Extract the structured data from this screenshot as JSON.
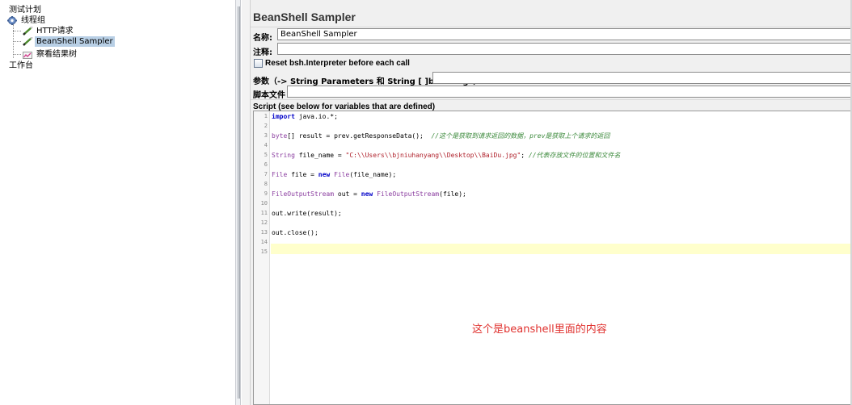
{
  "tree": {
    "items": [
      {
        "label": "测试计划",
        "icon": "test-plan-icon"
      },
      {
        "label": "线程组",
        "icon": "thread-group-gear-icon"
      },
      {
        "label": "HTTP请求",
        "icon": "http-sampler-pencil-icon"
      },
      {
        "label": "BeanShell Sampler",
        "icon": "beanshell-sampler-pencil-icon"
      },
      {
        "label": "察看结果树",
        "icon": "view-results-tree-icon"
      },
      {
        "label": "工作台",
        "icon": ""
      }
    ]
  },
  "panel": {
    "title": "BeanShell Sampler",
    "name_label": "名称:",
    "name_value": "BeanShell Sampler",
    "comment_label": "注释:",
    "comment_value": "",
    "reset_label": "Reset bsh.Interpreter before each call",
    "reset_checked": false,
    "params_label": "参数（-> String Parameters 和 String [ ]bash.args）",
    "params_value": "",
    "script_file_label": "脚本文件",
    "script_file_value": "",
    "script_label": "Script (see below for variables that are defined)"
  },
  "editor": {
    "line_numbers": [
      "1",
      "2",
      "3",
      "4",
      "5",
      "6",
      "7",
      "8",
      "9",
      "10",
      "11",
      "12",
      "13",
      "14",
      "15"
    ],
    "lines": [
      {
        "tokens": [
          {
            "t": "import",
            "c": "kw"
          },
          {
            "t": " java.io.*;",
            "c": ""
          }
        ]
      },
      {
        "tokens": []
      },
      {
        "tokens": [
          {
            "t": "byte",
            "c": "ty"
          },
          {
            "t": "[] result = prev.getResponseData();  ",
            "c": ""
          },
          {
            "t": "//这个是获取到请求返回的数据，prev是获取上个请求的返回",
            "c": "cm"
          }
        ]
      },
      {
        "tokens": []
      },
      {
        "tokens": [
          {
            "t": "String",
            "c": "ty"
          },
          {
            "t": " file_name = ",
            "c": ""
          },
          {
            "t": "\"C:\\\\Users\\\\bjniuhanyang\\\\Desktop\\\\BaiDu.jpg\"",
            "c": "st"
          },
          {
            "t": "; ",
            "c": ""
          },
          {
            "t": "//代表存放文件的位置和文件名",
            "c": "cm"
          }
        ]
      },
      {
        "tokens": []
      },
      {
        "tokens": [
          {
            "t": "File",
            "c": "ty"
          },
          {
            "t": " file = ",
            "c": ""
          },
          {
            "t": "new",
            "c": "kw"
          },
          {
            "t": " ",
            "c": ""
          },
          {
            "t": "File",
            "c": "ty"
          },
          {
            "t": "(file_name);",
            "c": ""
          }
        ]
      },
      {
        "tokens": []
      },
      {
        "tokens": [
          {
            "t": "FileOutputStream",
            "c": "ty"
          },
          {
            "t": " out = ",
            "c": ""
          },
          {
            "t": "new",
            "c": "kw"
          },
          {
            "t": " ",
            "c": ""
          },
          {
            "t": "FileOutputStream",
            "c": "ty"
          },
          {
            "t": "(file);",
            "c": ""
          }
        ]
      },
      {
        "tokens": []
      },
      {
        "tokens": [
          {
            "t": "out.write(result);",
            "c": ""
          }
        ]
      },
      {
        "tokens": []
      },
      {
        "tokens": [
          {
            "t": "out.close();",
            "c": ""
          }
        ]
      },
      {
        "tokens": []
      },
      {
        "tokens": []
      }
    ],
    "annotation": "这个是beanshell里面的内容",
    "annotation_color": "#e0312e"
  }
}
